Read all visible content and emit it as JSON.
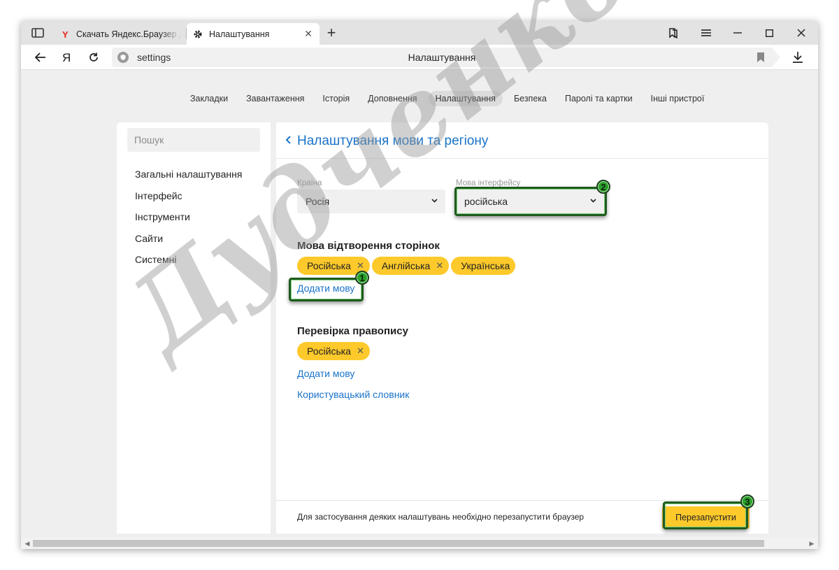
{
  "tabs": [
    {
      "title": "Скачать Яндекс.Браузер для",
      "favicon": "yandex-y-icon"
    },
    {
      "title": "Налаштування",
      "favicon": "gear-icon",
      "active": true
    }
  ],
  "address": {
    "url": "settings",
    "page_title": "Налаштування"
  },
  "nav": [
    "Закладки",
    "Завантаження",
    "Історія",
    "Доповнення",
    "Налаштування",
    "Безпека",
    "Паролі та картки",
    "Інші пристрої"
  ],
  "sidebar": {
    "search_placeholder": "Пошук",
    "items": [
      "Загальні налаштування",
      "Інтерфейс",
      "Інструменти",
      "Сайти",
      "Системні"
    ]
  },
  "main": {
    "title": "Налаштування мови та регіону",
    "country": {
      "label": "Країна",
      "value": "Росія"
    },
    "ui_language": {
      "label": "Мова інтерфейсу",
      "value": "російська"
    },
    "page_language": {
      "title": "Мова відтворення сторінок",
      "chips": [
        "Російська",
        "Англійська",
        "Українська"
      ],
      "add_link": "Додати мову"
    },
    "spellcheck": {
      "title": "Перевірка правопису",
      "chips": [
        "Російська"
      ],
      "add_link": "Додати мову",
      "dictionary_link": "Користувацький словник"
    },
    "footer": {
      "note": "Для застосування деяких налаштувань необхідно перезапустити браузер",
      "restart_button": "Перезапустити"
    }
  },
  "callouts": [
    "1",
    "2",
    "3"
  ],
  "watermark": "Дудченко LIVE",
  "colors": {
    "accent_yellow": "#fdc92b",
    "link_blue": "#1a73c8",
    "callout_green": "#2aa12a"
  }
}
